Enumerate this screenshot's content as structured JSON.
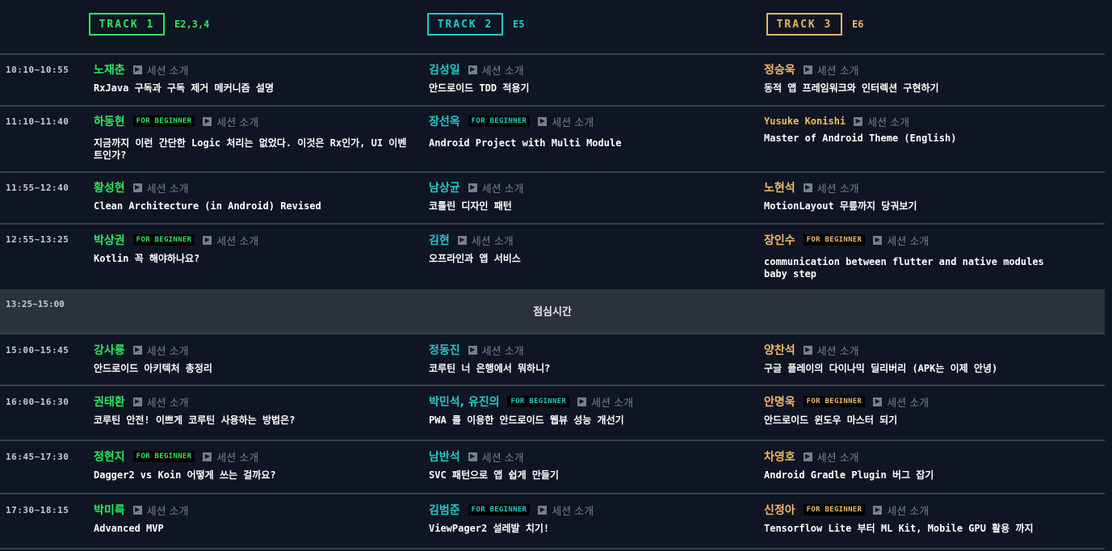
{
  "tracks": [
    {
      "label": "TRACK 1",
      "room": "E2,3,4",
      "color": "#2ee65a"
    },
    {
      "label": "TRACK 2",
      "room": "E5",
      "color": "#22c9c9"
    },
    {
      "label": "TRACK 3",
      "room": "E6",
      "color": "#e8b46a"
    }
  ],
  "intro_label": "세션 소개",
  "badge_label": "FOR BEGINNER",
  "lunch": {
    "time": "13:25~15:00",
    "label": "점심시간"
  },
  "rows": [
    {
      "time": "10:10~10:55",
      "sessions": [
        {
          "speaker": "노재춘",
          "title": "RxJava 구독과 구독 제거 메커니즘 설명"
        },
        {
          "speaker": "김성일",
          "title": "안드로이드 TDD 적용기"
        },
        {
          "speaker": "정승욱",
          "title": "동적 앱 프레임워크와 인터렉션 구현하기"
        }
      ]
    },
    {
      "time": "11:10~11:40",
      "sessions": [
        {
          "speaker": "하동현",
          "title": "지금까지 이런 간단한 Logic 처리는 없었다. 이것은 Rx인가, UI 이벤트인가?"
        },
        {
          "speaker": "장선옥",
          "title": "Android Project with Multi Module"
        },
        {
          "speaker": "Yusuke Konishi",
          "title": "Master of Android Theme (English)"
        }
      ]
    },
    {
      "time": "11:55~12:40",
      "sessions": [
        {
          "speaker": "황성현",
          "title": "Clean Architecture (in Android) Revised"
        },
        {
          "speaker": "남상균",
          "title": "코틀린 디자인 패턴"
        },
        {
          "speaker": "노현석",
          "title": "MotionLayout 무릎까지 당궈보기"
        }
      ]
    },
    {
      "time": "12:55~13:25",
      "sessions": [
        {
          "speaker": "박상권",
          "title": "Kotlin 꼭 해야하나요?"
        },
        {
          "speaker": "김현",
          "title": "오프라인과 앱 서비스"
        },
        {
          "speaker": "장인수",
          "title": "communication between flutter and native modules baby step"
        }
      ]
    },
    {
      "time": "15:00~15:45",
      "sessions": [
        {
          "speaker": "강사룡",
          "title": "안드로이드 아키텍처 총정리"
        },
        {
          "speaker": "정동진",
          "title": "코루틴 너 은행에서 뭐하니?"
        },
        {
          "speaker": "양찬석",
          "title": "구글 플레이의 다이나믹 딜리버리 (APK는 이제 안녕)"
        }
      ]
    },
    {
      "time": "16:00~16:30",
      "sessions": [
        {
          "speaker": "권태환",
          "title": "코루틴 안전! 이쁘게 코루틴 사용하는 방법은?"
        },
        {
          "speaker": "박민석, 유진의",
          "title": "PWA 를 이용한 안드로이드 웹뷰 성능 개선기"
        },
        {
          "speaker": "안명욱",
          "title": "안드로이드 윈도우 마스터 되기"
        }
      ]
    },
    {
      "time": "16:45~17:30",
      "sessions": [
        {
          "speaker": "정현지",
          "title": "Dagger2 vs Koin 어떻게 쓰는 걸까요?"
        },
        {
          "speaker": "남반석",
          "title": "SVC 패턴으로 앱 쉽게 만들기"
        },
        {
          "speaker": "차영호",
          "title": "Android Gradle Plugin 버그 잡기"
        }
      ]
    },
    {
      "time": "17:30~18:15",
      "sessions": [
        {
          "speaker": "박미륵",
          "title": "Advanced MVP"
        },
        {
          "speaker": "김범준",
          "title": "ViewPager2 설레발 치기!"
        },
        {
          "speaker": "신정아",
          "title": "Tensorflow Lite 부터 ML Kit, Mobile GPU 활용 까지"
        }
      ]
    }
  ]
}
